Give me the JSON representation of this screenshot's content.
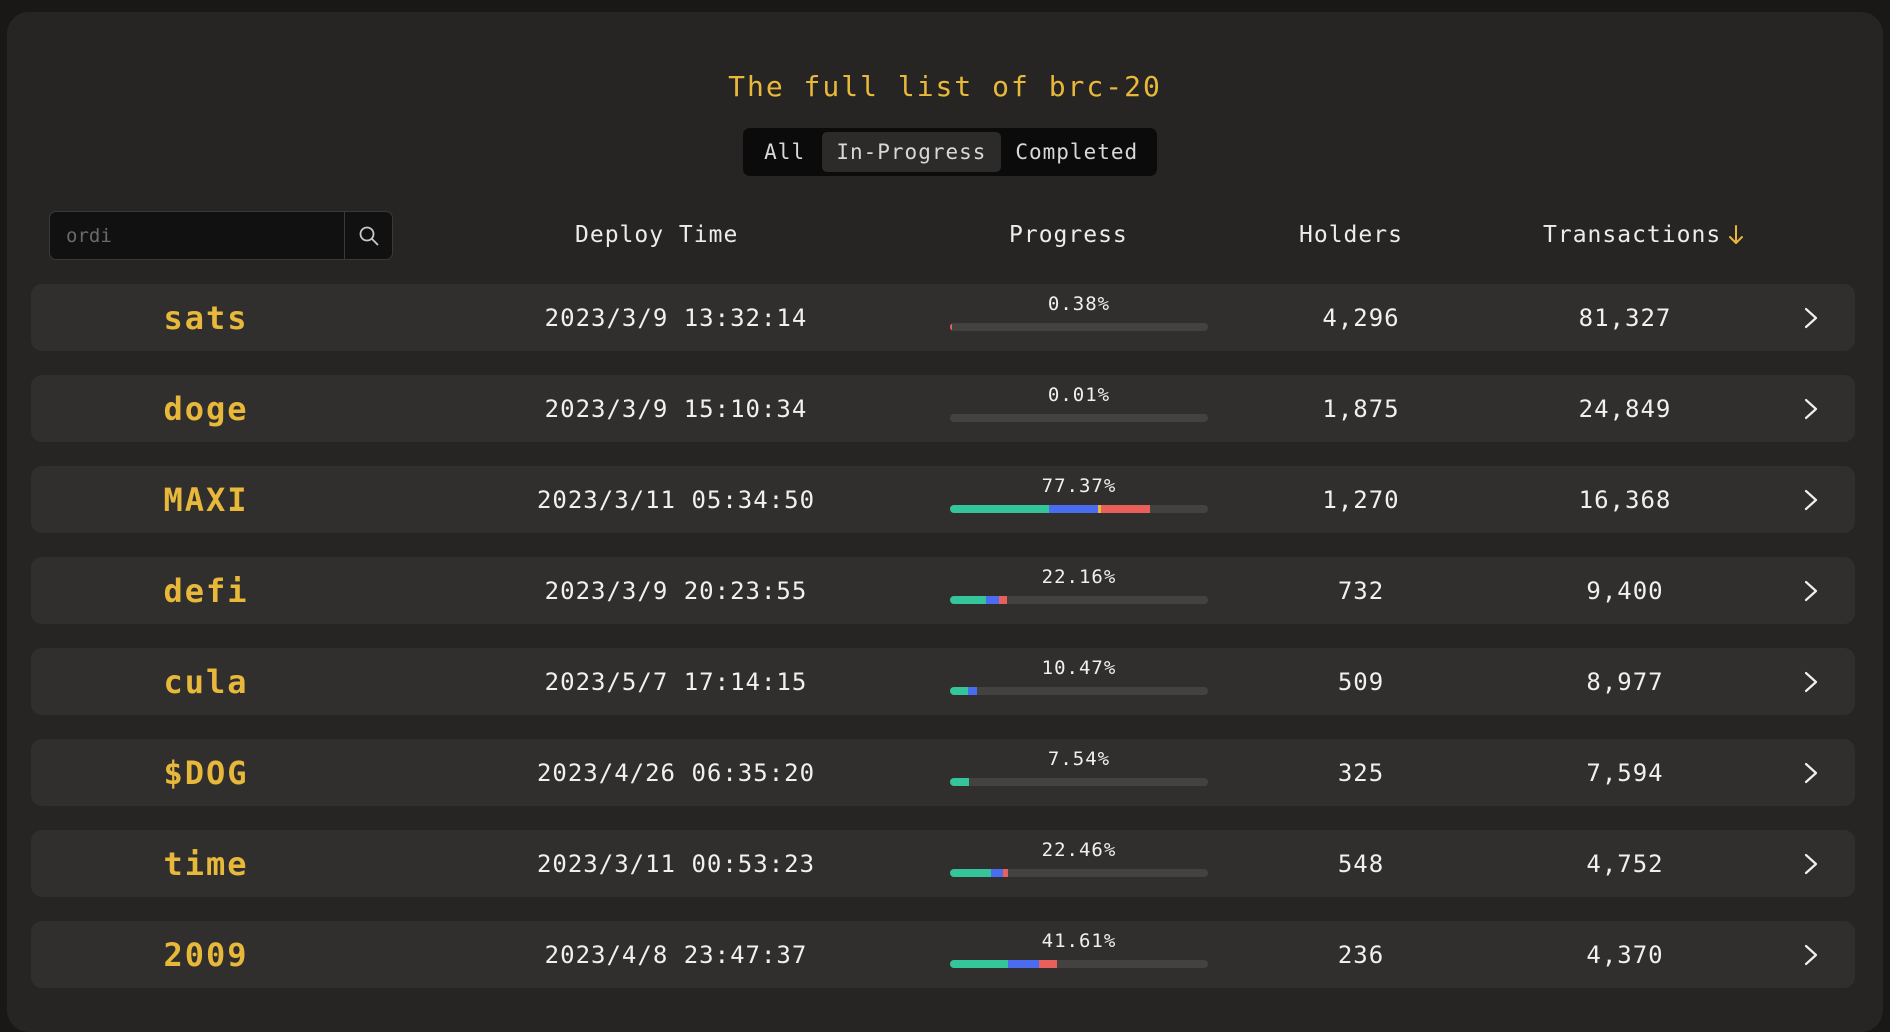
{
  "page": {
    "title": "The full list of brc-20"
  },
  "tabs": [
    {
      "label": "All",
      "active": false
    },
    {
      "label": "In-Progress",
      "active": true
    },
    {
      "label": "Completed",
      "active": false
    }
  ],
  "search": {
    "placeholder": "ordi",
    "value": ""
  },
  "columns": {
    "deploy_time": "Deploy Time",
    "progress": "Progress",
    "holders": "Holders",
    "transactions": "Transactions"
  },
  "sort": {
    "column": "transactions",
    "direction": "desc",
    "icon": "arrow-down-icon"
  },
  "colors": {
    "accent": "#e8b83a",
    "green": "#34c59a",
    "blue": "#4a6cf0",
    "red": "#e9605a",
    "track": "#434241"
  },
  "rows": [
    {
      "name": "sats",
      "deploy_time": "2023/3/9 13:32:14",
      "progress": "0.38%",
      "holders": "4,296",
      "transactions": "81,327",
      "bar": [
        {
          "color": "#e9605a",
          "fraction": 0.006
        }
      ]
    },
    {
      "name": "doge",
      "deploy_time": "2023/3/9 15:10:34",
      "progress": "0.01%",
      "holders": "1,875",
      "transactions": "24,849",
      "bar": []
    },
    {
      "name": "MAXI",
      "deploy_time": "2023/3/11 05:34:50",
      "progress": "77.37%",
      "holders": "1,270",
      "transactions": "16,368",
      "bar": [
        {
          "color": "#34c59a",
          "fraction": 0.385
        },
        {
          "color": "#4a6cf0",
          "fraction": 0.19
        },
        {
          "color": "#e8b83a",
          "fraction": 0.01
        },
        {
          "color": "#e9605a",
          "fraction": 0.19
        }
      ]
    },
    {
      "name": "defi",
      "deploy_time": "2023/3/9 20:23:55",
      "progress": "22.16%",
      "holders": "732",
      "transactions": "9,400",
      "bar": [
        {
          "color": "#34c59a",
          "fraction": 0.14
        },
        {
          "color": "#4a6cf0",
          "fraction": 0.05
        },
        {
          "color": "#e9605a",
          "fraction": 0.03
        }
      ]
    },
    {
      "name": "cula",
      "deploy_time": "2023/5/7 17:14:15",
      "progress": "10.47%",
      "holders": "509",
      "transactions": "8,977",
      "bar": [
        {
          "color": "#34c59a",
          "fraction": 0.07
        },
        {
          "color": "#4a6cf0",
          "fraction": 0.035
        }
      ]
    },
    {
      "name": "$DOG",
      "deploy_time": "2023/4/26 06:35:20",
      "progress": "7.54%",
      "holders": "325",
      "transactions": "7,594",
      "bar": [
        {
          "color": "#34c59a",
          "fraction": 0.0754
        }
      ]
    },
    {
      "name": "time",
      "deploy_time": "2023/3/11 00:53:23",
      "progress": "22.46%",
      "holders": "548",
      "transactions": "4,752",
      "bar": [
        {
          "color": "#34c59a",
          "fraction": 0.16
        },
        {
          "color": "#4a6cf0",
          "fraction": 0.045
        },
        {
          "color": "#e9605a",
          "fraction": 0.02
        }
      ]
    },
    {
      "name": "2009",
      "deploy_time": "2023/4/8 23:47:37",
      "progress": "41.61%",
      "holders": "236",
      "transactions": "4,370",
      "bar": [
        {
          "color": "#34c59a",
          "fraction": 0.225
        },
        {
          "color": "#4a6cf0",
          "fraction": 0.12
        },
        {
          "color": "#e9605a",
          "fraction": 0.07
        }
      ]
    }
  ]
}
